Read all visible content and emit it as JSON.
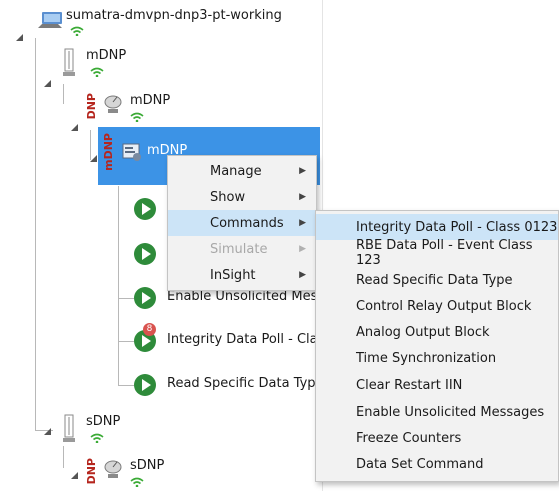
{
  "tree": {
    "root_label": "sumatra-dmvpn-dnp3-pt-working",
    "master_label": "mDNP",
    "master_app_label": "mDNP",
    "selected_label": "mDNP",
    "slave_label": "sDNP",
    "slave_app_label": "sDNP",
    "dnp_badge": "DNP",
    "mdnp_badge": "mDNP",
    "error_badge": "8",
    "action_labels": [
      "Enable Unsolicited Mes",
      "Integrity Data Poll - Clas",
      "Read Specific Data Type"
    ]
  },
  "context_menu": {
    "items": [
      {
        "label": "Manage",
        "has_submenu": true,
        "enabled": true
      },
      {
        "label": "Show",
        "has_submenu": true,
        "enabled": true
      },
      {
        "label": "Commands",
        "has_submenu": true,
        "enabled": true
      },
      {
        "label": "Simulate",
        "has_submenu": true,
        "enabled": false
      },
      {
        "label": "InSight",
        "has_submenu": true,
        "enabled": true
      }
    ],
    "chevron": "▶"
  },
  "commands_submenu": {
    "items": [
      "Integrity Data Poll - Class 0123",
      "RBE Data Poll - Event Class 123",
      "Read Specific Data Type",
      "Control Relay Output Block",
      "Analog Output Block",
      "Time Synchronization",
      "Clear Restart IIN",
      "Enable Unsolicited Messages",
      "Freeze Counters",
      "Data Set Command"
    ]
  },
  "colors": {
    "selection": "#3c93e6",
    "menu_highlight": "#cce4f7",
    "play_green": "#2e8b3a",
    "wifi_green": "#3aaa35",
    "dnp_red": "#b5261e"
  }
}
